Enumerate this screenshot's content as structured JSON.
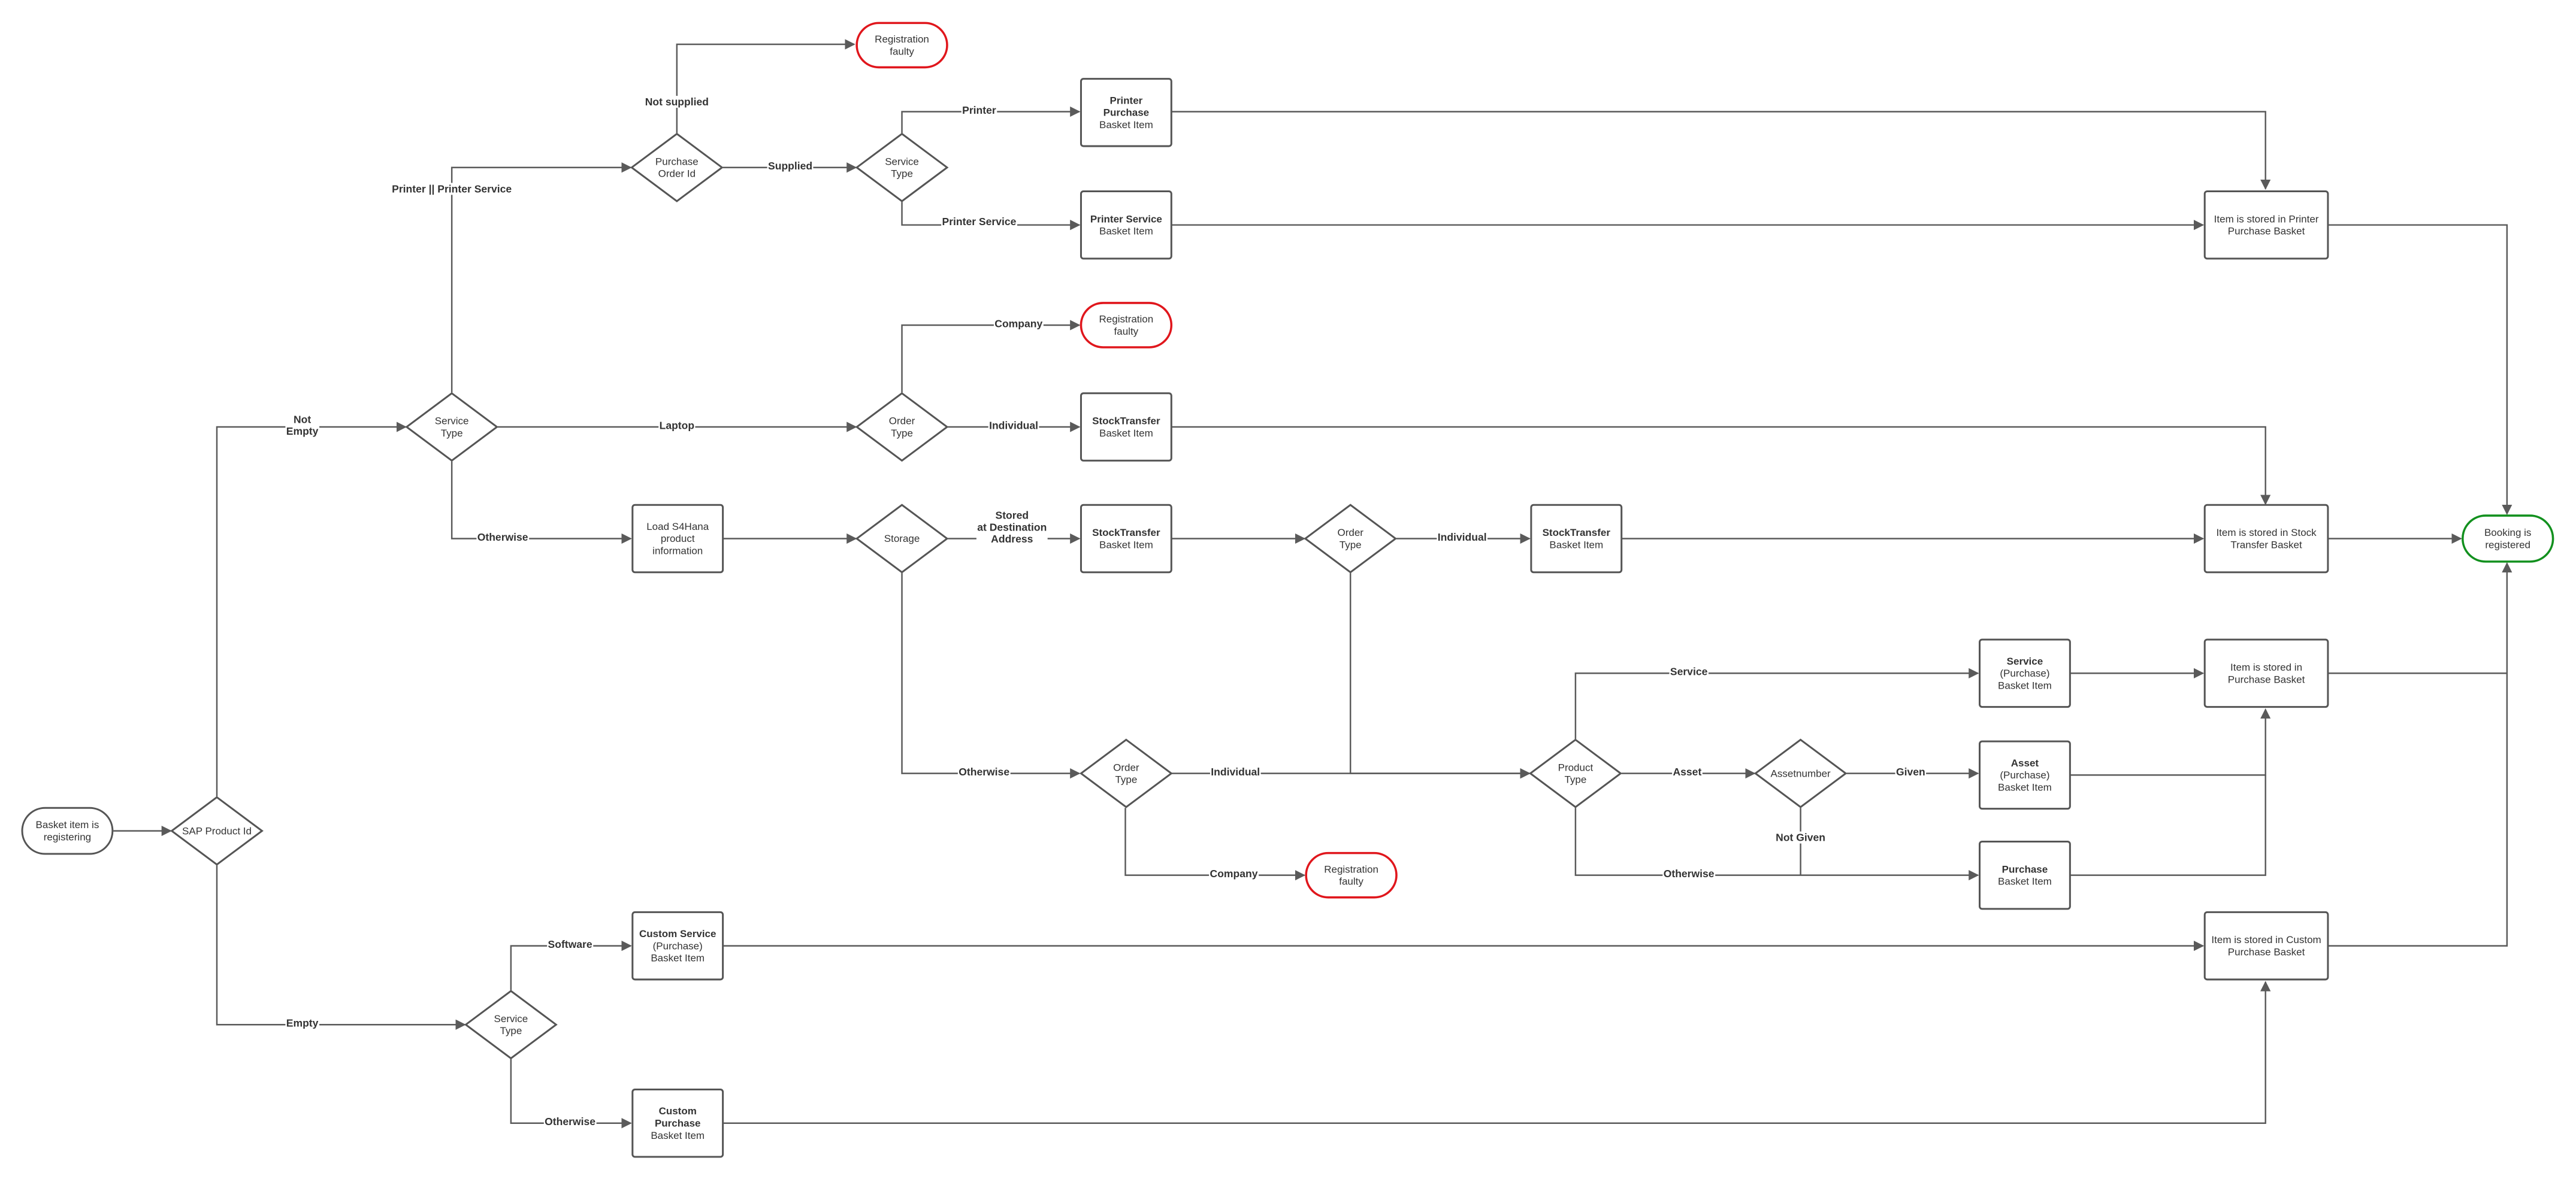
{
  "colors": {
    "line": "#5a5a5a",
    "error": "#e0161c",
    "success": "#12901e",
    "text": "#333333"
  },
  "nodes": [
    {
      "id": "start",
      "shape": "terminal",
      "lines": [
        {
          "t": "Basket item is"
        },
        {
          "t": "registering"
        }
      ]
    },
    {
      "id": "sap",
      "shape": "decision",
      "lines": [
        {
          "t": "SAP Product Id"
        }
      ]
    },
    {
      "id": "st1",
      "shape": "decision",
      "lines": [
        {
          "t": "Service"
        },
        {
          "t": "Type"
        }
      ]
    },
    {
      "id": "po",
      "shape": "decision",
      "lines": [
        {
          "t": "Purchase"
        },
        {
          "t": "Order Id"
        }
      ]
    },
    {
      "id": "faulty1",
      "shape": "terminal",
      "status": "error",
      "lines": [
        {
          "t": "Registration"
        },
        {
          "t": "faulty"
        }
      ]
    },
    {
      "id": "st2",
      "shape": "decision",
      "lines": [
        {
          "t": "Service"
        },
        {
          "t": "Type"
        }
      ]
    },
    {
      "id": "pp",
      "shape": "process",
      "lines": [
        {
          "t": "Printer",
          "b": true
        },
        {
          "t": "Purchase",
          "b": true
        },
        {
          "t": "Basket Item"
        }
      ]
    },
    {
      "id": "ps",
      "shape": "process",
      "lines": [
        {
          "t": "Printer Service",
          "b": true
        },
        {
          "t": "Basket Item"
        }
      ]
    },
    {
      "id": "order1",
      "shape": "decision",
      "lines": [
        {
          "t": "Order"
        },
        {
          "t": "Type"
        }
      ]
    },
    {
      "id": "faulty2",
      "shape": "terminal",
      "status": "error",
      "lines": [
        {
          "t": "Registration"
        },
        {
          "t": "faulty"
        }
      ]
    },
    {
      "id": "stock1",
      "shape": "process",
      "lines": [
        {
          "t": "StockTransfer",
          "b": true
        },
        {
          "t": "Basket Item"
        }
      ]
    },
    {
      "id": "load",
      "shape": "process",
      "lines": [
        {
          "t": "Load S4Hana"
        },
        {
          "t": "product"
        },
        {
          "t": "information"
        }
      ]
    },
    {
      "id": "storage",
      "shape": "decision",
      "lines": [
        {
          "t": "Storage"
        }
      ]
    },
    {
      "id": "stock2",
      "shape": "process",
      "lines": [
        {
          "t": "StockTransfer",
          "b": true
        },
        {
          "t": "Basket Item"
        }
      ]
    },
    {
      "id": "order2",
      "shape": "decision",
      "lines": [
        {
          "t": "Order"
        },
        {
          "t": "Type"
        }
      ]
    },
    {
      "id": "stock3",
      "shape": "process",
      "lines": [
        {
          "t": "StockTransfer",
          "b": true
        },
        {
          "t": "Basket Item"
        }
      ]
    },
    {
      "id": "order3",
      "shape": "decision",
      "lines": [
        {
          "t": "Order"
        },
        {
          "t": "Type"
        }
      ]
    },
    {
      "id": "faulty3",
      "shape": "terminal",
      "status": "error",
      "lines": [
        {
          "t": "Registration"
        },
        {
          "t": "faulty"
        }
      ]
    },
    {
      "id": "product",
      "shape": "decision",
      "lines": [
        {
          "t": "Product"
        },
        {
          "t": "Type"
        }
      ]
    },
    {
      "id": "assetnum",
      "shape": "decision",
      "lines": [
        {
          "t": "Assetnumber"
        }
      ]
    },
    {
      "id": "servp",
      "shape": "process",
      "lines": [
        {
          "t": "Service",
          "b": true
        },
        {
          "t": "(Purchase)"
        },
        {
          "t": "Basket Item"
        }
      ]
    },
    {
      "id": "asset",
      "shape": "process",
      "lines": [
        {
          "t": "Asset",
          "b": true
        },
        {
          "t": "(Purchase)"
        },
        {
          "t": "Basket Item"
        }
      ]
    },
    {
      "id": "purchase",
      "shape": "process",
      "lines": [
        {
          "t": "Purchase",
          "b": true
        },
        {
          "t": "Basket Item"
        }
      ]
    },
    {
      "id": "st3",
      "shape": "decision",
      "lines": [
        {
          "t": "Service"
        },
        {
          "t": "Type"
        }
      ]
    },
    {
      "id": "cserv",
      "shape": "process",
      "lines": [
        {
          "t": "Custom Service",
          "b": true
        },
        {
          "t": "(Purchase)"
        },
        {
          "t": "Basket Item"
        }
      ]
    },
    {
      "id": "cpurch",
      "shape": "process",
      "lines": [
        {
          "t": "Custom",
          "b": true
        },
        {
          "t": "Purchase",
          "b": true
        },
        {
          "t": "Basket Item"
        }
      ]
    },
    {
      "id": "store_printer",
      "shape": "process",
      "lines": [
        {
          "t": "Item is stored in Printer"
        },
        {
          "t": "Purchase Basket"
        }
      ]
    },
    {
      "id": "store_stock",
      "shape": "process",
      "lines": [
        {
          "t": "Item is stored in Stock"
        },
        {
          "t": "Transfer Basket"
        }
      ]
    },
    {
      "id": "store_purchase",
      "shape": "process",
      "lines": [
        {
          "t": "Item is stored in"
        },
        {
          "t": "Purchase Basket"
        }
      ]
    },
    {
      "id": "store_custom",
      "shape": "process",
      "lines": [
        {
          "t": "Item is stored in Custom"
        },
        {
          "t": "Purchase Basket"
        }
      ]
    },
    {
      "id": "booking",
      "shape": "terminal",
      "status": "success",
      "lines": [
        {
          "t": "Booking is"
        },
        {
          "t": "registered"
        }
      ]
    }
  ],
  "edges": [
    {
      "id": "e_start_sap",
      "label": ""
    },
    {
      "id": "e_sap_st1",
      "label": "Not\nEmpty"
    },
    {
      "id": "e_sap_st3",
      "label": "Empty"
    },
    {
      "id": "e_st1_po",
      "label": "Printer || Printer Service"
    },
    {
      "id": "e_st1_order1",
      "label": "Laptop"
    },
    {
      "id": "e_st1_load",
      "label": "Otherwise"
    },
    {
      "id": "e_po_faulty1",
      "label": "Not supplied"
    },
    {
      "id": "e_po_st2",
      "label": "Supplied"
    },
    {
      "id": "e_st2_pp",
      "label": "Printer"
    },
    {
      "id": "e_st2_ps",
      "label": "Printer Service"
    },
    {
      "id": "e_pp_store",
      "label": ""
    },
    {
      "id": "e_ps_store",
      "label": ""
    },
    {
      "id": "e_storeprinter_booking",
      "label": ""
    },
    {
      "id": "e_order1_faulty2",
      "label": "Company"
    },
    {
      "id": "e_order1_stock1",
      "label": "Individual"
    },
    {
      "id": "e_stock1_store",
      "label": ""
    },
    {
      "id": "e_load_storage",
      "label": ""
    },
    {
      "id": "e_storage_stock2",
      "label": "Stored\nat Destination\nAddress"
    },
    {
      "id": "e_stock2_order2",
      "label": ""
    },
    {
      "id": "e_order2_stock3",
      "label": "Individual"
    },
    {
      "id": "e_stock3_store",
      "label": ""
    },
    {
      "id": "e_storestock_booking",
      "label": ""
    },
    {
      "id": "e_storage_order3",
      "label": "Otherwise"
    },
    {
      "id": "e_order2_product",
      "label": ""
    },
    {
      "id": "e_order3_product",
      "label": "Individual"
    },
    {
      "id": "e_order3_faulty3",
      "label": "Company"
    },
    {
      "id": "e_product_servp",
      "label": "Service"
    },
    {
      "id": "e_product_assetnum",
      "label": "Asset"
    },
    {
      "id": "e_assetnum_asset",
      "label": "Given"
    },
    {
      "id": "e_product_purchase",
      "label": "Otherwise"
    },
    {
      "id": "e_assetnum_purchase",
      "label": "Not Given"
    },
    {
      "id": "e_servp_store",
      "label": ""
    },
    {
      "id": "e_asset_store",
      "label": ""
    },
    {
      "id": "e_purchase_store",
      "label": ""
    },
    {
      "id": "e_storepurchase_booking",
      "label": ""
    },
    {
      "id": "e_st3_cserv",
      "label": "Software"
    },
    {
      "id": "e_st3_cpurch",
      "label": "Otherwise"
    },
    {
      "id": "e_cserv_store",
      "label": ""
    },
    {
      "id": "e_cpurch_store",
      "label": ""
    },
    {
      "id": "e_storecustom_booking",
      "label": ""
    }
  ]
}
